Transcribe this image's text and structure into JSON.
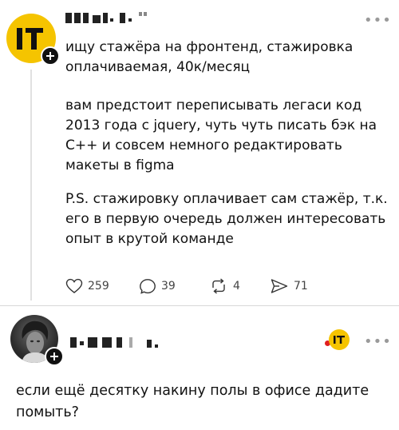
{
  "post": {
    "paragraphs": [
      "ищу стажёра на фронтенд, стажировка оплачиваемая, 40к/месяц",
      "вам предстоит переписывать легаси код 2013 года с jquery, чуть чуть писать бэк на С++ и совсем немного редактировать макеты в figma",
      "P.S. стажировку оплачивает сам стажёр, т.к. его в первую очередь должен интересовать опыт в крутой команде"
    ],
    "actions": {
      "likes": "259",
      "comments": "39",
      "reposts": "4",
      "shares": "71"
    }
  },
  "reply": {
    "text": "если ещё десятку накину полы в офисе дадите помыть?"
  },
  "icons": {
    "avatar_badge": "plus-icon",
    "more": "more-horizontal-icon",
    "like": "heart-icon",
    "comment": "comment-bubble-icon",
    "repost": "repost-icon",
    "share": "send-icon"
  },
  "colors": {
    "brand_yellow": "#f5c400",
    "text": "#111111",
    "muted": "#9a9a9a",
    "divider": "#d8d8d8"
  }
}
